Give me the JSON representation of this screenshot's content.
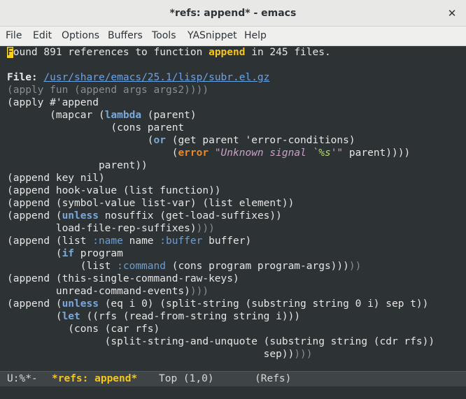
{
  "window": {
    "title": "*refs: append* - emacs",
    "close_glyph": "✕"
  },
  "menu": {
    "items": [
      "File",
      "Edit",
      "Options",
      "Buffers",
      "Tools",
      "YASnippet",
      "Help"
    ]
  },
  "editor": {
    "header": {
      "cursor_char": "F",
      "pre": "ound 891 references to function ",
      "fn": "append",
      "post": " in 245 files."
    },
    "file_label": "File:",
    "file_path": "/usr/share/emacs/25.1/lisp/subr.el.gz",
    "lines": [
      [
        [
          "dim",
          "(apply fun (append args args2))))"
        ]
      ],
      [
        [
          "",
          "(apply #'append"
        ]
      ],
      [
        [
          "",
          "       (mapcar ("
        ],
        [
          "kw",
          "lambda"
        ],
        [
          "",
          " (parent)"
        ]
      ],
      [
        [
          "",
          "                 (cons parent"
        ]
      ],
      [
        [
          "",
          "                       ("
        ],
        [
          "kw",
          "or"
        ],
        [
          "",
          " (get parent 'error-conditions)"
        ]
      ],
      [
        [
          "",
          "                           ("
        ],
        [
          "err",
          "error"
        ],
        [
          "",
          " "
        ],
        [
          "str",
          "\"Unknown signal `"
        ],
        [
          "fmt",
          "%s"
        ],
        [
          "str",
          "'\""
        ],
        [
          "",
          " parent))))"
        ]
      ],
      [
        [
          "",
          "               parent))"
        ]
      ],
      [
        [
          "",
          "(append key nil)"
        ]
      ],
      [
        [
          "",
          "(append hook-value (list function))"
        ]
      ],
      [
        [
          "",
          "(append (symbol-value list-var) (list element))"
        ]
      ],
      [
        [
          "",
          "(append ("
        ],
        [
          "kw",
          "unless"
        ],
        [
          "",
          " nosuffix (get-load-suffixes))"
        ]
      ],
      [
        [
          "",
          "        load-file-rep-suffixes)"
        ],
        [
          "dim",
          ")))"
        ]
      ],
      [
        [
          "",
          "(append (list "
        ],
        [
          "const",
          ":name"
        ],
        [
          "",
          " name "
        ],
        [
          "const",
          ":buffer"
        ],
        [
          "",
          " buffer)"
        ]
      ],
      [
        [
          "",
          "        ("
        ],
        [
          "kw",
          "if"
        ],
        [
          "",
          " program"
        ]
      ],
      [
        [
          "",
          "            (list "
        ],
        [
          "const",
          ":command"
        ],
        [
          "",
          " (cons program program-args)))"
        ],
        [
          "dim",
          "))"
        ]
      ],
      [
        [
          "",
          "(append (this-single-command-raw-keys)"
        ]
      ],
      [
        [
          "",
          "        unread-command-events)"
        ],
        [
          "dim",
          ")))"
        ]
      ],
      [
        [
          "",
          "(append ("
        ],
        [
          "kw",
          "unless"
        ],
        [
          "",
          " (eq i 0) (split-string (substring string 0 i) sep t))"
        ]
      ],
      [
        [
          "",
          "        ("
        ],
        [
          "kw",
          "let"
        ],
        [
          "",
          " ((rfs (read-from-string string i)))"
        ]
      ],
      [
        [
          "",
          "          (cons (car rfs)"
        ]
      ],
      [
        [
          "",
          "                (split-string-and-unquote (substring string (cdr rfs))"
        ]
      ],
      [
        [
          "",
          "                                          sep))"
        ],
        [
          "dim",
          ")))"
        ]
      ]
    ]
  },
  "modeline": {
    "status": "U:%*-",
    "buffer_name": "*refs: append*",
    "position": "Top (1,0)",
    "mode": "(Refs)"
  },
  "colors": {
    "background": "#2d3235",
    "highlight_yellow": "#f5c518",
    "keyword_blue": "#7ba7d9",
    "error_orange": "#e88a2a",
    "string_pink": "#c7a2c5",
    "link_blue": "#6aa2e6"
  }
}
